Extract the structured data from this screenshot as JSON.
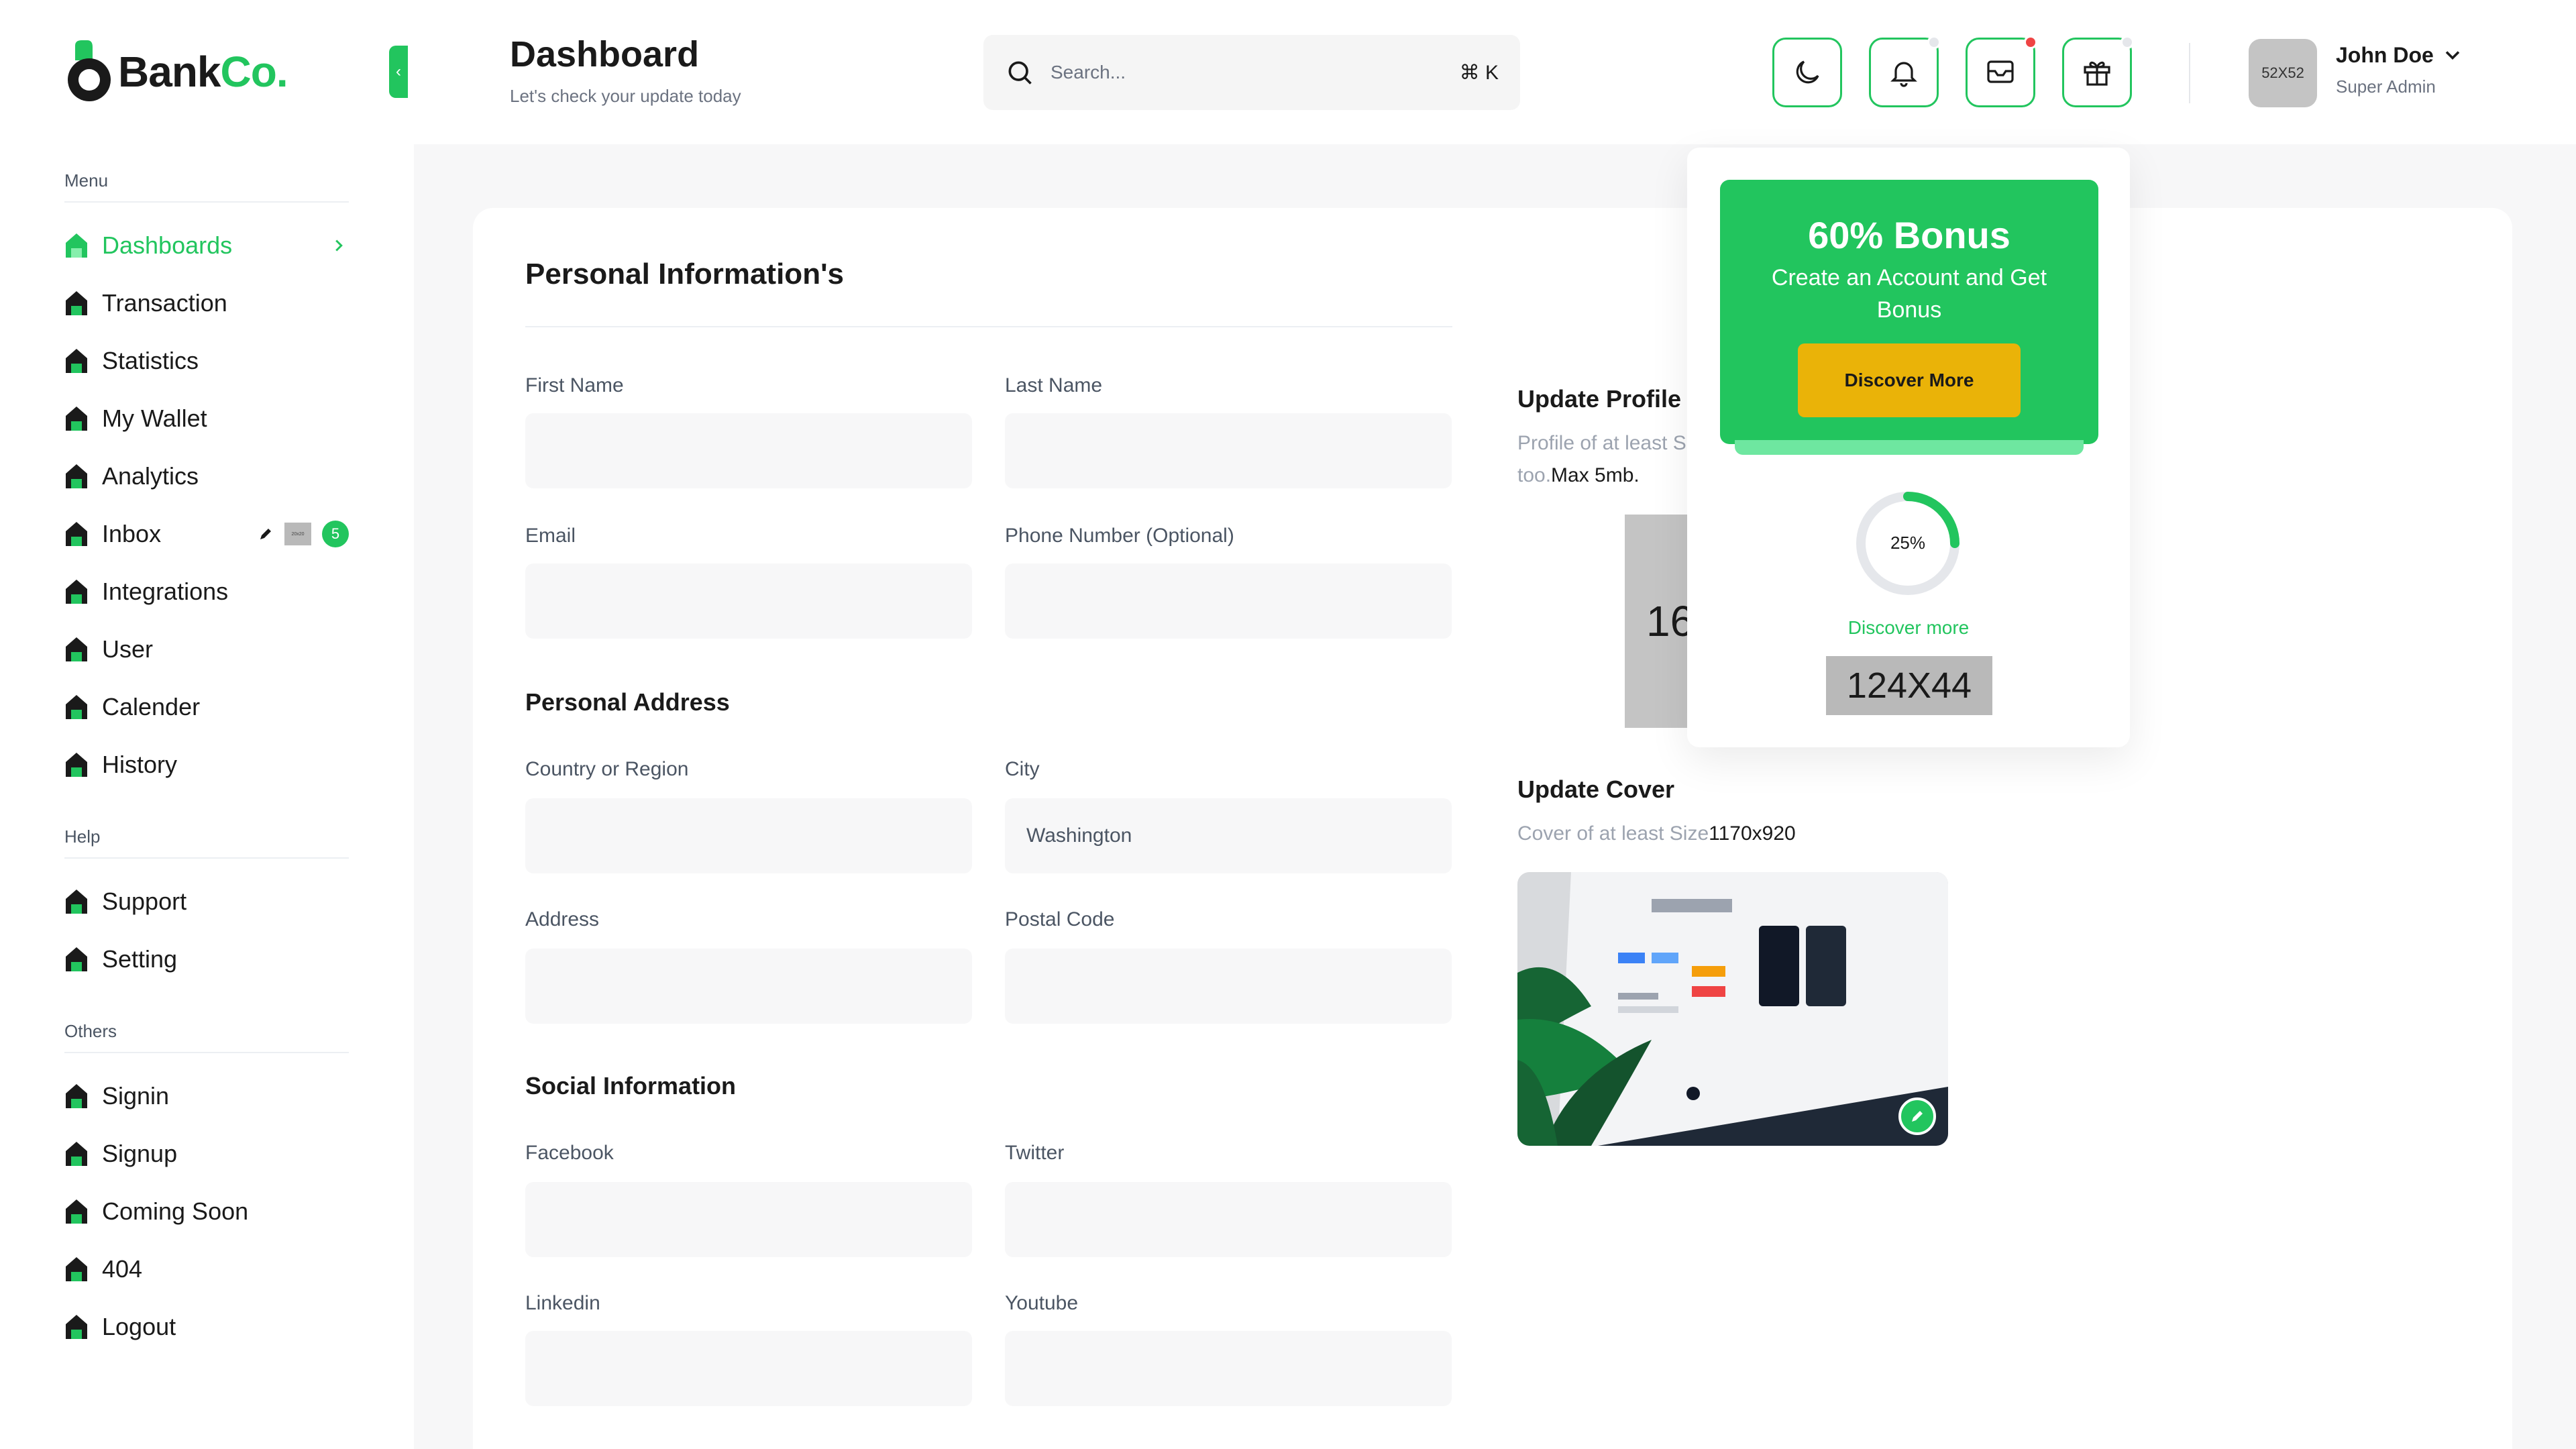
{
  "brand": {
    "name_main": "Bank",
    "name_accent": "Co.",
    "accent_color": "#22c55e"
  },
  "header": {
    "title": "Dashboard",
    "subtitle": "Let's check your update today",
    "search_placeholder": "Search...",
    "search_shortcut": "⌘ K",
    "avatar_placeholder": "52X52",
    "user_name": "John Doe",
    "user_role": "Super Admin"
  },
  "sidebar": {
    "menu_label": "Menu",
    "help_label": "Help",
    "others_label": "Others",
    "menu": [
      {
        "label": "Dashboards"
      },
      {
        "label": "Transaction"
      },
      {
        "label": "Statistics"
      },
      {
        "label": "My Wallet"
      },
      {
        "label": "Analytics"
      },
      {
        "label": "Inbox"
      },
      {
        "label": "Integrations"
      },
      {
        "label": "User"
      },
      {
        "label": "Calender"
      },
      {
        "label": "History"
      }
    ],
    "inbox_badge": "5",
    "inbox_thumb": "20x20",
    "help": [
      {
        "label": "Support"
      },
      {
        "label": "Setting"
      }
    ],
    "others": [
      {
        "label": "Signin"
      },
      {
        "label": "Signup"
      },
      {
        "label": "Coming Soon"
      },
      {
        "label": "404"
      },
      {
        "label": "Logout"
      }
    ]
  },
  "form": {
    "title": "Personal Information's",
    "first_name": "First Name",
    "last_name": "Last Name",
    "email": "Email",
    "phone": "Phone Number (Optional)",
    "address_title": "Personal Address",
    "country": "Country or Region",
    "city": "City",
    "city_value": "Washington",
    "address": "Address",
    "postal": "Postal Code",
    "social_title": "Social Information",
    "facebook": "Facebook",
    "twitter": "Twitter",
    "linkedin": "Linkedin",
    "youtube": "Youtube"
  },
  "profile": {
    "title": "Update Profile",
    "hint_1": "Profile of at least S",
    "hint_2_grey": "too.",
    "hint_2_dark": "Max 5mb.",
    "placeholder": "16"
  },
  "cover": {
    "title": "Update Cover",
    "hint_grey": "Cover of at least Size",
    "hint_dark": "1170x920"
  },
  "popup": {
    "bonus_title": "60% Bonus",
    "bonus_text": "Create an Account and Get Bonus",
    "button": "Discover More",
    "progress_label": "25%",
    "progress": 0.25,
    "link": "Discover more",
    "placeholder": "124X44"
  },
  "status_colors": {
    "notification_dot": "#e5e7eb",
    "message_dot": "#ef4444",
    "gift_dot": "#e5e7eb"
  }
}
